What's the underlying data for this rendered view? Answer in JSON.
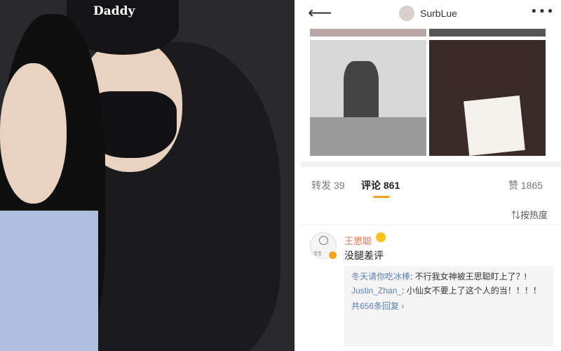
{
  "photo": {
    "cap_text": "Daddy"
  },
  "header": {
    "username": "SurbLue"
  },
  "tabs": [
    {
      "label": "转发",
      "count": "39"
    },
    {
      "label": "评论",
      "count": "861"
    },
    {
      "label": "赞",
      "count": "1865"
    }
  ],
  "sort": {
    "label": "按热度"
  },
  "comment": {
    "user": "王思聪",
    "text": "没腿差评",
    "avatar_caption": "宝宝",
    "replies": [
      {
        "user": "冬天请你吃冰棒",
        "text": ": 不行我女神被王思聪盯上了？!"
      },
      {
        "user": "Justin_Zhan_",
        "text": ": 小仙女不要上了这个人的当！！！！"
      }
    ],
    "more_replies": "共656条回复 ›"
  },
  "colors": {
    "accent": "#f7a21b",
    "link": "#5b7fb2",
    "name": "#eb7350"
  }
}
